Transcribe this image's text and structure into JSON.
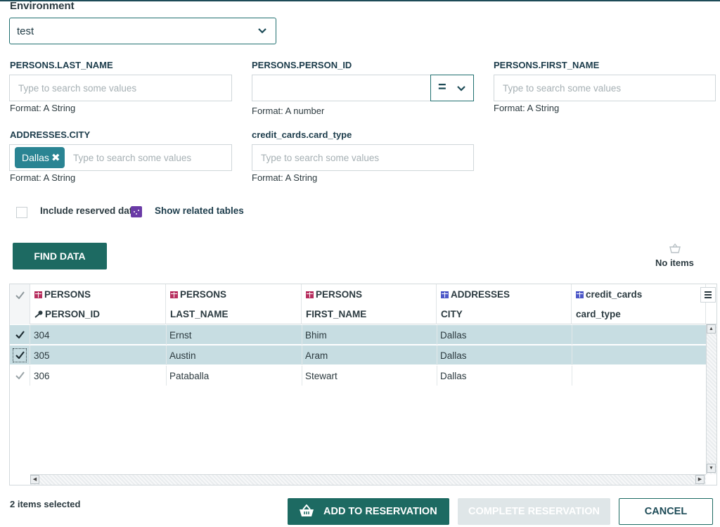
{
  "environment": {
    "label": "Environment",
    "value": "test"
  },
  "filters": {
    "last_name": {
      "label": "PERSONS.LAST_NAME",
      "placeholder": "Type to search some values",
      "format": "Format: A String"
    },
    "person_id": {
      "label": "PERSONS.PERSON_ID",
      "operator": "=",
      "format": "Format: A number"
    },
    "first_name": {
      "label": "PERSONS.FIRST_NAME",
      "placeholder": "Type to search some values",
      "format": "Format: A String"
    },
    "city": {
      "label": "ADDRESSES.CITY",
      "chip": "Dallas",
      "placeholder": "Type to search some values",
      "format": "Format: A String"
    },
    "card_type": {
      "label": "credit_cards.card_type",
      "placeholder": "Type to search some values",
      "format": "Format: A String"
    }
  },
  "options": {
    "include_reserved": "Include reserved data",
    "show_related": "Show related tables"
  },
  "find_button": "FIND DATA",
  "cart": {
    "status": "No items"
  },
  "grid": {
    "columns": [
      {
        "table": "PERSONS",
        "field": "PERSON_ID",
        "table_color": "#b72f5f",
        "key": true
      },
      {
        "table": "PERSONS",
        "field": "LAST_NAME",
        "table_color": "#b72f5f"
      },
      {
        "table": "PERSONS",
        "field": "FIRST_NAME",
        "table_color": "#b72f5f"
      },
      {
        "table": "ADDRESSES",
        "field": "CITY",
        "table_color": "#4d58c8"
      },
      {
        "table": "credit_cards",
        "field": "card_type",
        "table_color": "#4d58c8"
      }
    ],
    "rows": [
      {
        "selected": true,
        "cells": [
          "304",
          "Ernst",
          "Bhim",
          "Dallas",
          ""
        ]
      },
      {
        "selected": true,
        "cells": [
          "305",
          "Austin",
          "Aram",
          "Dallas",
          ""
        ]
      },
      {
        "selected": false,
        "cells": [
          "306",
          "Pataballa",
          "Stewart",
          "Dallas",
          ""
        ]
      }
    ]
  },
  "footer": {
    "selection": "2 items selected",
    "add_button": "ADD TO RESERVATION",
    "complete_button": "COMPLETE RESERVATION",
    "cancel_button": "CANCEL"
  },
  "colors": {
    "primary": "#1d6a62",
    "selected_row": "#c7dde2",
    "chip": "#2a8493"
  }
}
